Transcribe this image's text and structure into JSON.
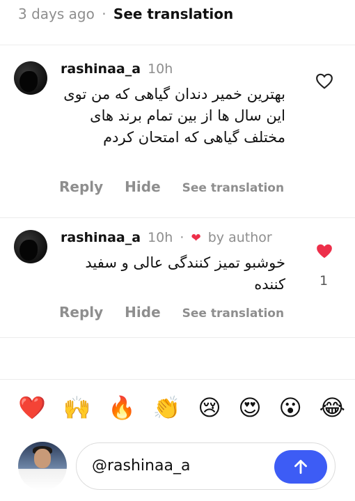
{
  "top": {
    "age": "3 days ago",
    "separator": "·",
    "see_translation": "See translation"
  },
  "comments": [
    {
      "username": "rashinaa_a",
      "time": "10h",
      "text": "بهترین خمیر دندان گیاهی که من توی این سال ها از بین تمام برند های مختلف گیاهی که امتحان کردم",
      "reply": "Reply",
      "hide": "Hide",
      "see_translation": "See translation",
      "liked_by_author": false,
      "like_count": ""
    },
    {
      "username": "rashinaa_a",
      "time": "10h",
      "separator": "·",
      "by_author": "by author",
      "text": "خوشبو تمیز کنندگی عالی و سفید کننده",
      "reply": "Reply",
      "hide": "Hide",
      "see_translation": "See translation",
      "liked_by_author": true,
      "like_count": "1"
    }
  ],
  "quick_reactions": [
    "❤️",
    "🙌",
    "🔥",
    "👏",
    "😢",
    "😍",
    "😮",
    "😂"
  ],
  "composer": {
    "value": "@rashinaa_a"
  },
  "colors": {
    "accent": "#3d5cf5",
    "heart": "#ed2f4a"
  }
}
